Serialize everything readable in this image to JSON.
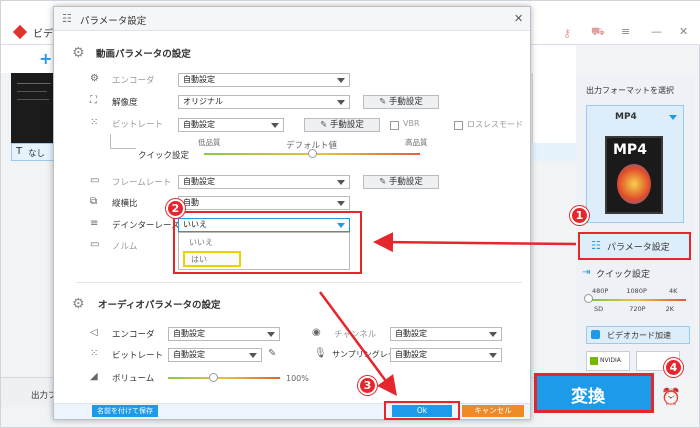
{
  "background_app": {
    "title": "ビデ",
    "add_symbol": "+",
    "output_format_label": "出力フォーマットを選択",
    "format_name": "MP4",
    "format_thumb_text": "MP4",
    "quick_settings_label": "クイック設定",
    "quick_ticks_top": [
      "480P",
      "1080P",
      "4K"
    ],
    "quick_ticks_bottom": [
      "SD",
      "720P",
      "2K"
    ],
    "gpu_accel_label": "ビデオカード加速",
    "nvidia": "NVIDIA",
    "convert_label": "変換",
    "output_folder_label": "出力フォ",
    "subtitle_label": "なし",
    "param_settings_label": "パラメータ設定"
  },
  "dialog": {
    "title": "パラメータ設定",
    "video_section": "動画パラメータの設定",
    "encoder_label": "エンコーダ",
    "encoder_value": "自動設定",
    "resolution_label": "解像度",
    "resolution_value": "オリジナル",
    "bitrate_label": "ビットレート",
    "bitrate_value": "自動設定",
    "manual_setting": "手動設定",
    "vbr_label": "VBR",
    "lossless_label": "ロスレスモード",
    "quick_setting_label": "クイック設定",
    "low_quality": "低品質",
    "default_value": "デフォルト値",
    "high_quality": "高品質",
    "framerate_label": "フレームレート",
    "framerate_value": "自動設定",
    "aspect_label": "縦横比",
    "aspect_value": "自動",
    "deinterlace_label": "デインターレース",
    "deinterlace_value": "いいえ",
    "norm_label": "ノルム",
    "dropdown_options": [
      "いいえ",
      "はい"
    ],
    "audio_section": "オーディオパラメータの設定",
    "a_encoder_label": "エンコーダ",
    "a_encoder_value": "自動設定",
    "channel_label": "チャンネル",
    "channel_value": "自動設定",
    "a_bitrate_label": "ビットレート",
    "a_bitrate_value": "自動設定",
    "samplerate_label": "サンプリングレート",
    "samplerate_value": "自動設定",
    "volume_label": "ボリューム",
    "volume_value": "100%",
    "volume_level": 0.4,
    "quality_level": 0.5,
    "save_as_name": "名前を付けて保存",
    "ok": "Ok",
    "cancel": "キャンセル"
  },
  "badges": [
    "1",
    "2",
    "3",
    "4"
  ],
  "colors": {
    "accent_blue": "#1e9be8",
    "annotation_red": "#e6262d",
    "highlight_yellow": "#ecd200",
    "cancel_orange": "#f08a26"
  }
}
